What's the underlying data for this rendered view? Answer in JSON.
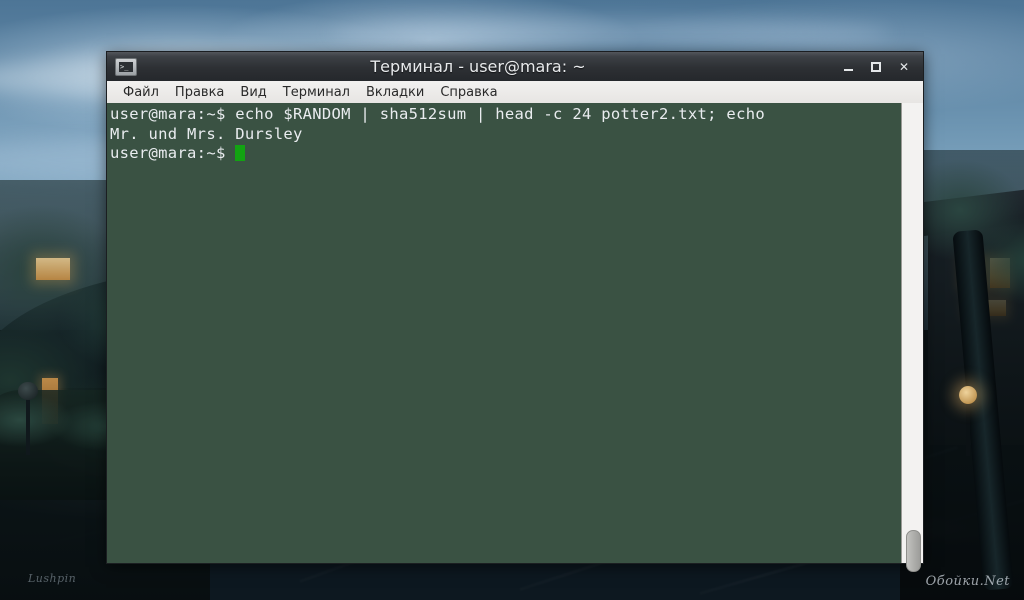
{
  "desktop": {
    "wallpaper_description": "evening street scene with blue cloudy sky, wet pavement, dark trees and a lit house",
    "watermark_left": "Lushpin",
    "watermark_right": "Обойки.Net",
    "sky_color": "#6d95b2",
    "street_color": "#3f6480"
  },
  "window": {
    "title": "Терминал - user@mara: ~",
    "icon": "terminal-icon",
    "icon_glyph": ">_",
    "controls": {
      "minimize": "–",
      "maximize": "□",
      "close": "✕"
    },
    "menu": [
      {
        "label": "Файл"
      },
      {
        "label": "Правка"
      },
      {
        "label": "Вид"
      },
      {
        "label": "Терминал"
      },
      {
        "label": "Вкладки"
      },
      {
        "label": "Справка"
      }
    ],
    "titlebar_color": "#2d3034",
    "menubar_color": "#ece9e7"
  },
  "terminal": {
    "background_color": "#3a5243",
    "foreground_color": "#e9ecef",
    "cursor_color": "#12a312",
    "lines": [
      {
        "text": "user@mara:~$ echo $RANDOM | sha512sum | head -c 24 potter2.txt; echo"
      },
      {
        "text": "Mr. und Mrs. Dursley"
      },
      {
        "text": "user@mara:~$ "
      }
    ],
    "prompt": "user@mara:~$",
    "command": "echo $RANDOM | sha512sum | head -c 24 potter2.txt; echo",
    "output": "Mr. und Mrs. Dursley",
    "scrollbar": {
      "thumb_position": "bottom"
    }
  }
}
